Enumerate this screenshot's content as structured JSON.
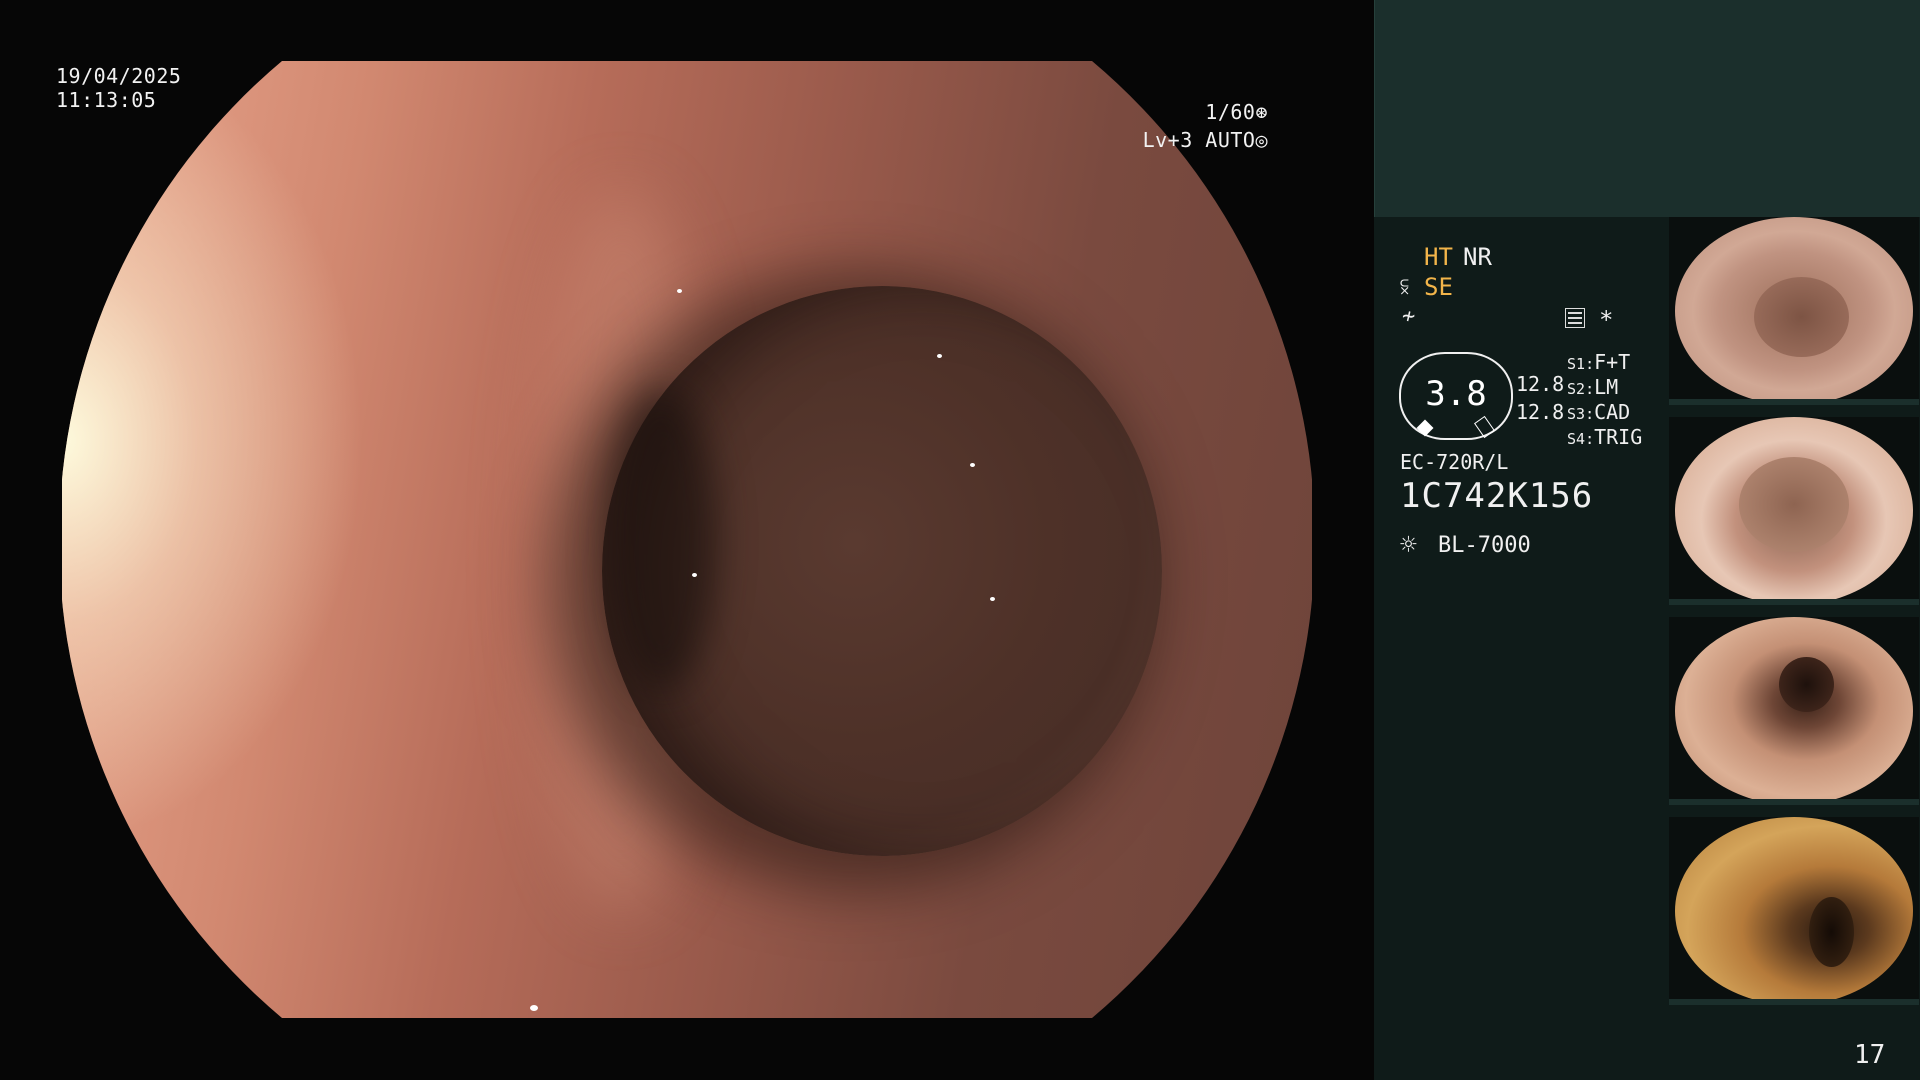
{
  "overlay": {
    "date": "19/04/2025",
    "time": "11:13:05",
    "shutter": "1/60⊛",
    "levels": "Lv+3 AUTO◎"
  },
  "panel": {
    "ht": "HT",
    "nr": "NR",
    "se_icon": "⫁",
    "se": "SE",
    "f_icon": "≁",
    "star": "*",
    "gauge_value": "3.8",
    "num1": "12.8",
    "num2": "12.8",
    "switches": [
      {
        "key": "S1",
        "value": "F+T"
      },
      {
        "key": "S2",
        "value": "LM"
      },
      {
        "key": "S3",
        "value": "CAD"
      },
      {
        "key": "S4",
        "value": "TRIG"
      }
    ],
    "model": "EC-720R/L",
    "serial": "1C742K156",
    "light_icon": "☼",
    "light": "BL-7000",
    "page_number": "17"
  },
  "colors": {
    "accent_yellow": "#f3b54a",
    "panel_top": "#1b2f2c",
    "panel_bottom": "#0f1b19"
  },
  "thumbnails": [
    "thumb-1",
    "thumb-2",
    "thumb-3",
    "thumb-4"
  ]
}
